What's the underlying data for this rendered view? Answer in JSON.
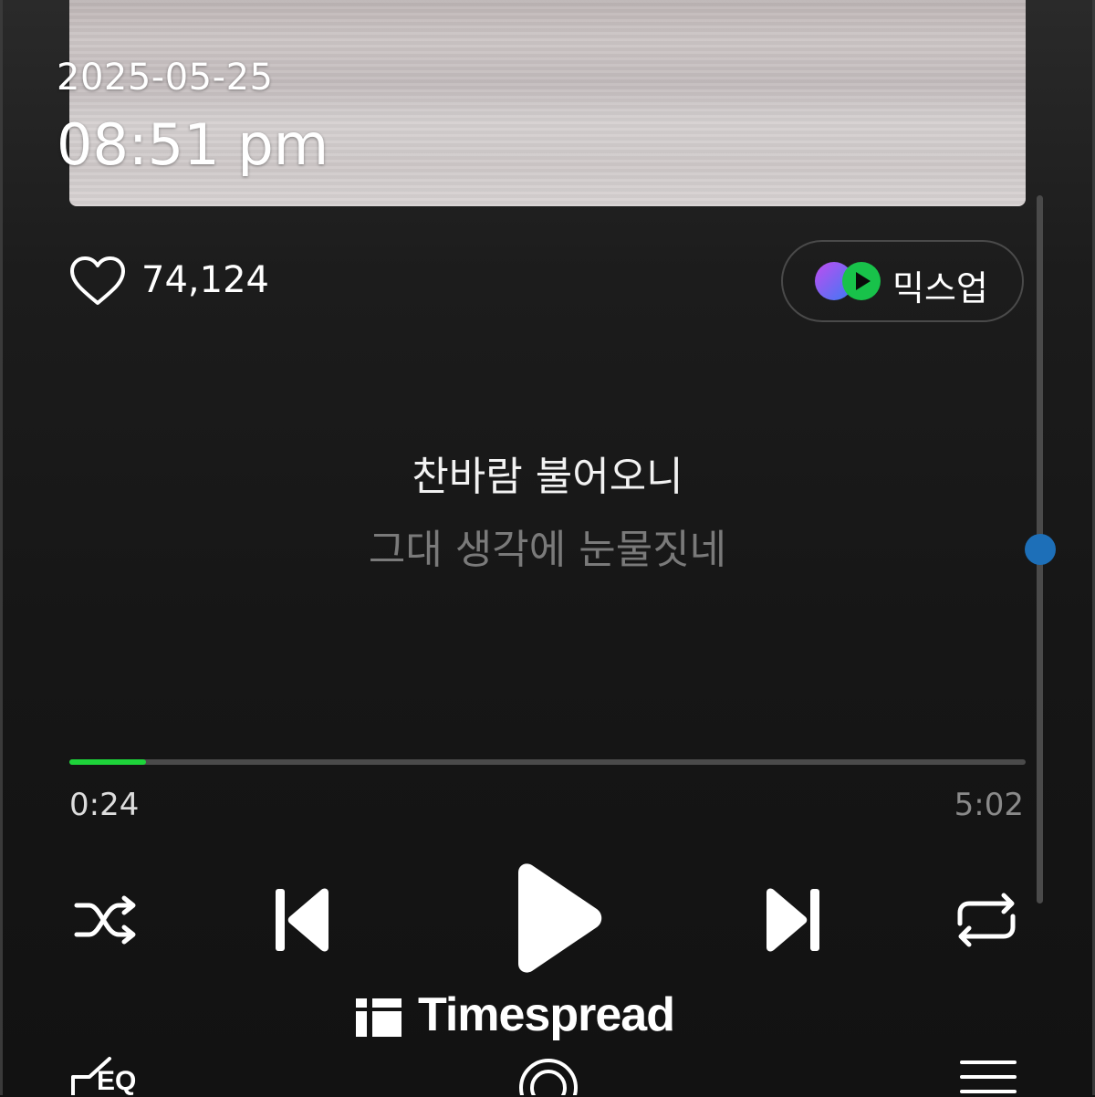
{
  "timestamp": {
    "date": "2025-05-25",
    "time": "08:51 pm"
  },
  "song": {
    "like_count": "74,124",
    "mixup_label": "믹스업",
    "lyrics": {
      "current": "찬바람 불어오니",
      "next": "그대 생각에 눈물짓네"
    }
  },
  "playback": {
    "elapsed": "0:24",
    "total": "5:02",
    "progress_fraction": 0.08,
    "state": "paused"
  },
  "controls": {
    "shuffle": "shuffle-icon",
    "previous": "skip-previous-icon",
    "play": "play-icon",
    "next": "skip-next-icon",
    "repeat": "repeat-icon"
  },
  "bottom_bar": {
    "eq_label": "EQ"
  },
  "watermark": {
    "text": "Timespread"
  },
  "colors": {
    "progress": "#1ed33a",
    "scroll_thumb": "#1d6fb8",
    "lyric_current": "#f2f2f2",
    "lyric_next": "#7a7a7a"
  },
  "scroll": {
    "position_fraction": 0.48
  }
}
